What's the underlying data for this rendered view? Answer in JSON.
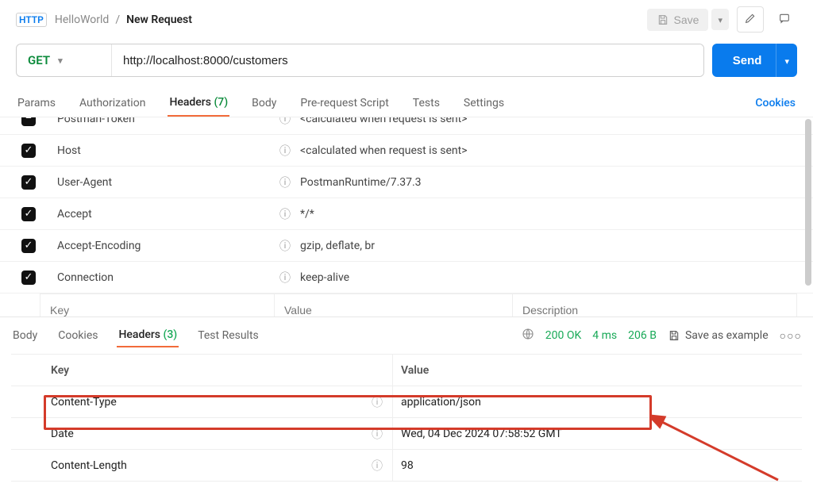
{
  "breadcrumb": {
    "parent": "HelloWorld",
    "sep": "/",
    "current": "New Request"
  },
  "badge": {
    "label": "HTTP"
  },
  "actions": {
    "save_label": "Save",
    "save_as_example": "Save as example"
  },
  "request": {
    "method": "GET",
    "url": "http://localhost:8000/customers",
    "send_label": "Send"
  },
  "req_tabs": {
    "items": [
      {
        "label": "Params"
      },
      {
        "label": "Authorization"
      },
      {
        "label": "Headers",
        "count": "(7)"
      },
      {
        "label": "Body"
      },
      {
        "label": "Pre-request Script"
      },
      {
        "label": "Tests"
      },
      {
        "label": "Settings"
      }
    ],
    "cookies_link": "Cookies"
  },
  "request_headers": [
    {
      "checked": "indet",
      "key": "Postman-Token",
      "value": "<calculated when request is sent>"
    },
    {
      "checked": "checked",
      "key": "Host",
      "value": "<calculated when request is sent>"
    },
    {
      "checked": "checked",
      "key": "User-Agent",
      "value": "PostmanRuntime/7.37.3"
    },
    {
      "checked": "checked",
      "key": "Accept",
      "value": "*/*"
    },
    {
      "checked": "checked",
      "key": "Accept-Encoding",
      "value": "gzip, deflate, br"
    },
    {
      "checked": "checked",
      "key": "Connection",
      "value": "keep-alive"
    }
  ],
  "header_input": {
    "key_ph": "Key",
    "value_ph": "Value",
    "desc_ph": "Description"
  },
  "response": {
    "tabs": [
      "Body",
      "Cookies",
      "Headers",
      "Test Results"
    ],
    "headers_count": "(3)",
    "status": "200 OK",
    "time": "4 ms",
    "size": "206 B",
    "columns": {
      "key": "Key",
      "value": "Value"
    },
    "headers": [
      {
        "key": "Content-Type",
        "value": "application/json"
      },
      {
        "key": "Date",
        "value": "Wed, 04 Dec 2024 07:58:52 GMT"
      },
      {
        "key": "Content-Length",
        "value": "98"
      }
    ]
  }
}
